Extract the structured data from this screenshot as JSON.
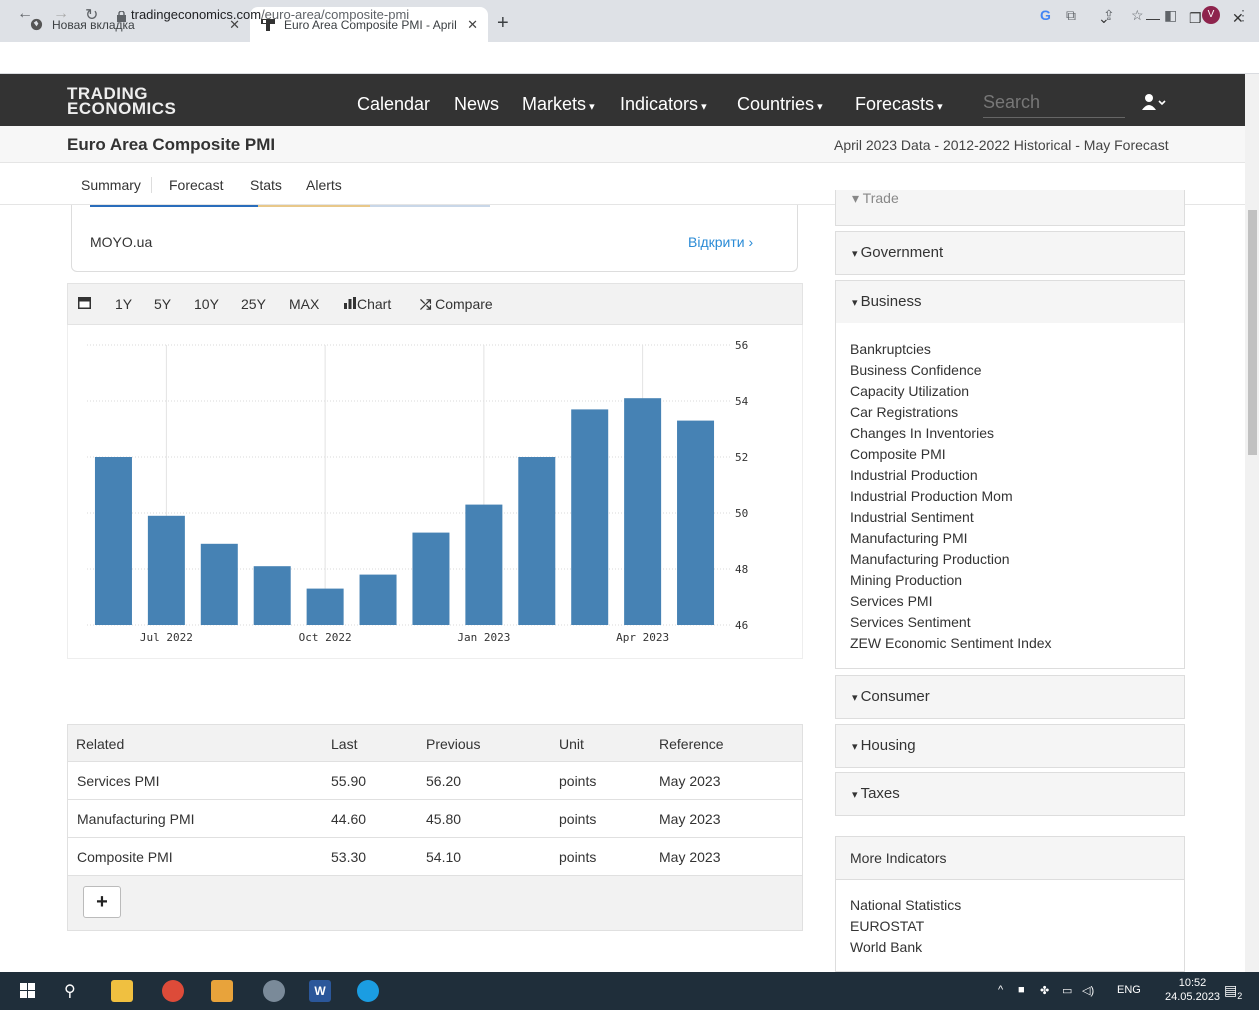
{
  "browser": {
    "tabs": [
      {
        "title": "Новая вкладка",
        "active": false
      },
      {
        "title": "Euro Area Composite PMI - April",
        "active": true
      }
    ],
    "url_host": "tradingeconomics.com",
    "url_path": "/euro-area/composite-pmi",
    "avatar_letter": "V"
  },
  "site": {
    "logo_line1": "TRADING",
    "logo_line2": "ECONOMICS",
    "nav": [
      "Calendar",
      "News",
      "Markets",
      "Indicators",
      "Countries",
      "Forecasts"
    ],
    "search_placeholder": "Search"
  },
  "page": {
    "title": "Euro Area Composite PMI",
    "subtitle": "April 2023 Data - 2012-2022 Historical - May Forecast",
    "tabs": [
      "Summary",
      "Forecast",
      "Stats",
      "Alerts"
    ]
  },
  "ad": {
    "name": "MOYO.ua",
    "link": "Відкрити"
  },
  "chart_toolbar": {
    "ranges": [
      "1Y",
      "5Y",
      "10Y",
      "25Y",
      "MAX"
    ],
    "chart_label": "Chart",
    "compare_label": "Compare"
  },
  "chart_data": {
    "type": "bar",
    "categories": [
      "Jun 2022",
      "Jul 2022",
      "Aug 2022",
      "Sep 2022",
      "Oct 2022",
      "Nov 2022",
      "Dec 2022",
      "Jan 2023",
      "Feb 2023",
      "Mar 2023",
      "Apr 2023",
      "May 2023"
    ],
    "values": [
      52.0,
      49.9,
      48.9,
      48.1,
      47.3,
      47.8,
      49.3,
      50.3,
      52.0,
      53.7,
      54.1,
      53.3
    ],
    "x_tick_labels": [
      "Jul 2022",
      "Oct 2022",
      "Jan 2023",
      "Apr 2023"
    ],
    "y_ticks": [
      46,
      48,
      50,
      52,
      54,
      56
    ],
    "ylim": [
      46,
      56
    ],
    "color": "#4682b4",
    "grid": true,
    "y_axis_side": "right"
  },
  "related": {
    "headers": [
      "Related",
      "Last",
      "Previous",
      "Unit",
      "Reference"
    ],
    "rows": [
      [
        "Services PMI",
        "55.90",
        "56.20",
        "points",
        "May 2023"
      ],
      [
        "Manufacturing PMI",
        "44.60",
        "45.80",
        "points",
        "May 2023"
      ],
      [
        "Composite PMI",
        "53.30",
        "54.10",
        "points",
        "May 2023"
      ]
    ],
    "add_label": "+"
  },
  "sidebar": {
    "partial_top": "Trade",
    "sections": [
      "Government",
      "Business",
      "Consumer",
      "Housing",
      "Taxes"
    ],
    "business_links": [
      "Bankruptcies",
      "Business Confidence",
      "Capacity Utilization",
      "Car Registrations",
      "Changes In Inventories",
      "Composite PMI",
      "Industrial Production",
      "Industrial Production Mom",
      "Industrial Sentiment",
      "Manufacturing PMI",
      "Manufacturing Production",
      "Mining Production",
      "Services PMI",
      "Services Sentiment",
      "ZEW Economic Sentiment Index"
    ],
    "more_title": "More Indicators",
    "more_links": [
      "National Statistics",
      "EUROSTAT",
      "World Bank"
    ]
  },
  "taskbar": {
    "lang": "ENG",
    "time": "10:52",
    "date": "24.05.2023",
    "notif_count": "2"
  }
}
